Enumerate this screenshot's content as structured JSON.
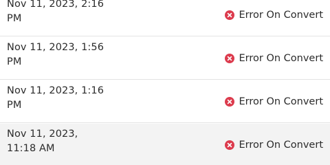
{
  "rows": [
    {
      "date": "Nov 11, 2023, 2:16 PM",
      "status": "Error On Convert",
      "status_icon": "error-x-circle-icon"
    },
    {
      "date": "Nov 11, 2023, 1:56 PM",
      "status": "Error On Convert",
      "status_icon": "error-x-circle-icon"
    },
    {
      "date": "Nov 11, 2023, 1:16 PM",
      "status": "Error On Convert",
      "status_icon": "error-x-circle-icon"
    },
    {
      "date": "Nov 11, 2023, 11:18 AM",
      "status": "Error On Convert",
      "status_icon": "error-x-circle-icon"
    }
  ],
  "colors": {
    "error": "#dc3b4d",
    "hover_row_bg": "#f3f3f3",
    "divider": "#e3e3e3"
  }
}
